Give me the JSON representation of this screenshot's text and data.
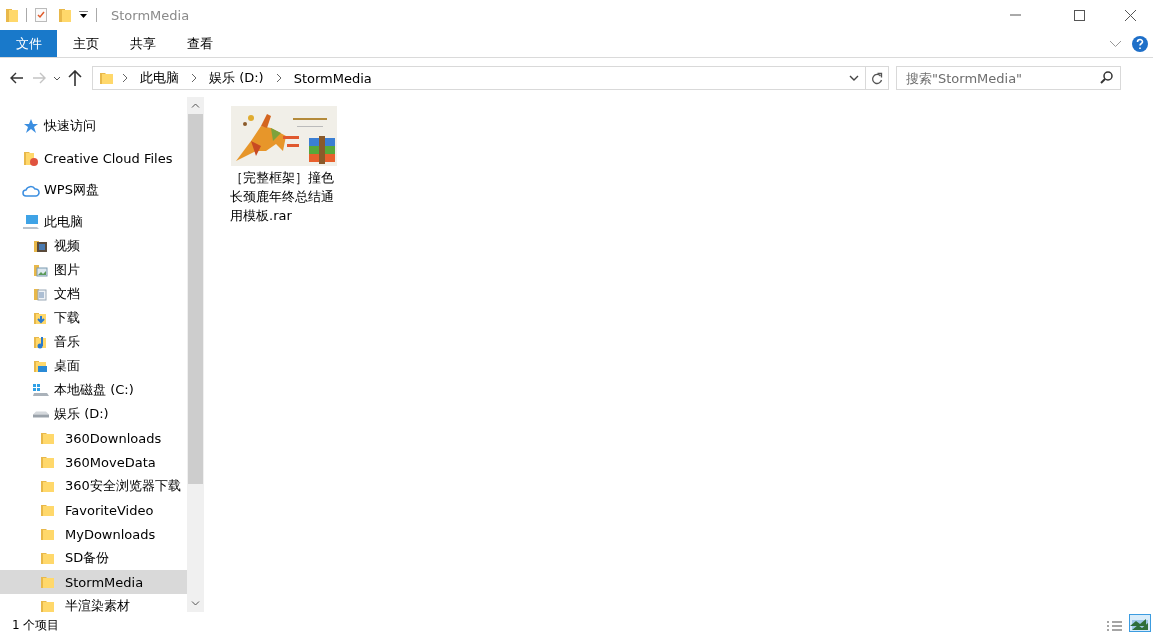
{
  "window": {
    "title": "StormMedia"
  },
  "ribbon_tabs": [
    {
      "label": "文件",
      "kind": "file",
      "selected": false
    },
    {
      "label": "主页",
      "kind": "tab",
      "selected": false
    },
    {
      "label": "共享",
      "kind": "tab",
      "selected": false
    },
    {
      "label": "查看",
      "kind": "tab",
      "selected": false
    }
  ],
  "navigation": {
    "back": {
      "disabled": false
    },
    "forward": {
      "disabled": true
    }
  },
  "address_bar": {
    "breadcrumbs": [
      "此电脑",
      "娱乐 (D:)",
      "StormMedia"
    ]
  },
  "search": {
    "placeholder": "搜索\"StormMedia\""
  },
  "sidebar": {
    "items": [
      {
        "label": "快速访问",
        "kind": "star",
        "selected": false
      },
      {
        "label": "Creative Cloud Files",
        "kind": "cc",
        "selected": false
      },
      {
        "label": "WPS网盘",
        "kind": "cloud",
        "selected": false
      },
      {
        "label": "此电脑",
        "kind": "pc",
        "selected": false,
        "children": [
          {
            "label": "视频",
            "kind": "video",
            "selected": false
          },
          {
            "label": "图片",
            "kind": "pictures",
            "selected": false
          },
          {
            "label": "文档",
            "kind": "documents",
            "selected": false
          },
          {
            "label": "下载",
            "kind": "downloads",
            "selected": false
          },
          {
            "label": "音乐",
            "kind": "music",
            "selected": false
          },
          {
            "label": "桌面",
            "kind": "desktop",
            "selected": false
          },
          {
            "label": "本地磁盘 (C:)",
            "kind": "sysdrive",
            "selected": false
          },
          {
            "label": "娱乐 (D:)",
            "kind": "drive",
            "selected": false,
            "children": [
              {
                "label": "360Downloads",
                "kind": "folder",
                "selected": false
              },
              {
                "label": "360MoveData",
                "kind": "folder",
                "selected": false
              },
              {
                "label": "360安全浏览器下载",
                "kind": "folder",
                "selected": false
              },
              {
                "label": "FavoriteVideo",
                "kind": "folder",
                "selected": false
              },
              {
                "label": "MyDownloads",
                "kind": "folder",
                "selected": false
              },
              {
                "label": "SD备份",
                "kind": "folder",
                "selected": false
              },
              {
                "label": "StormMedia",
                "kind": "folder",
                "selected": true
              },
              {
                "label": "半渲染素材",
                "kind": "folder",
                "selected": false
              }
            ]
          }
        ]
      }
    ]
  },
  "files": [
    {
      "name": "［完整框架］撞色长颈鹿年终总结通用模板.rar",
      "kind": "picture",
      "selected": false
    }
  ],
  "status_bar": {
    "item_count": "1 个项目"
  }
}
